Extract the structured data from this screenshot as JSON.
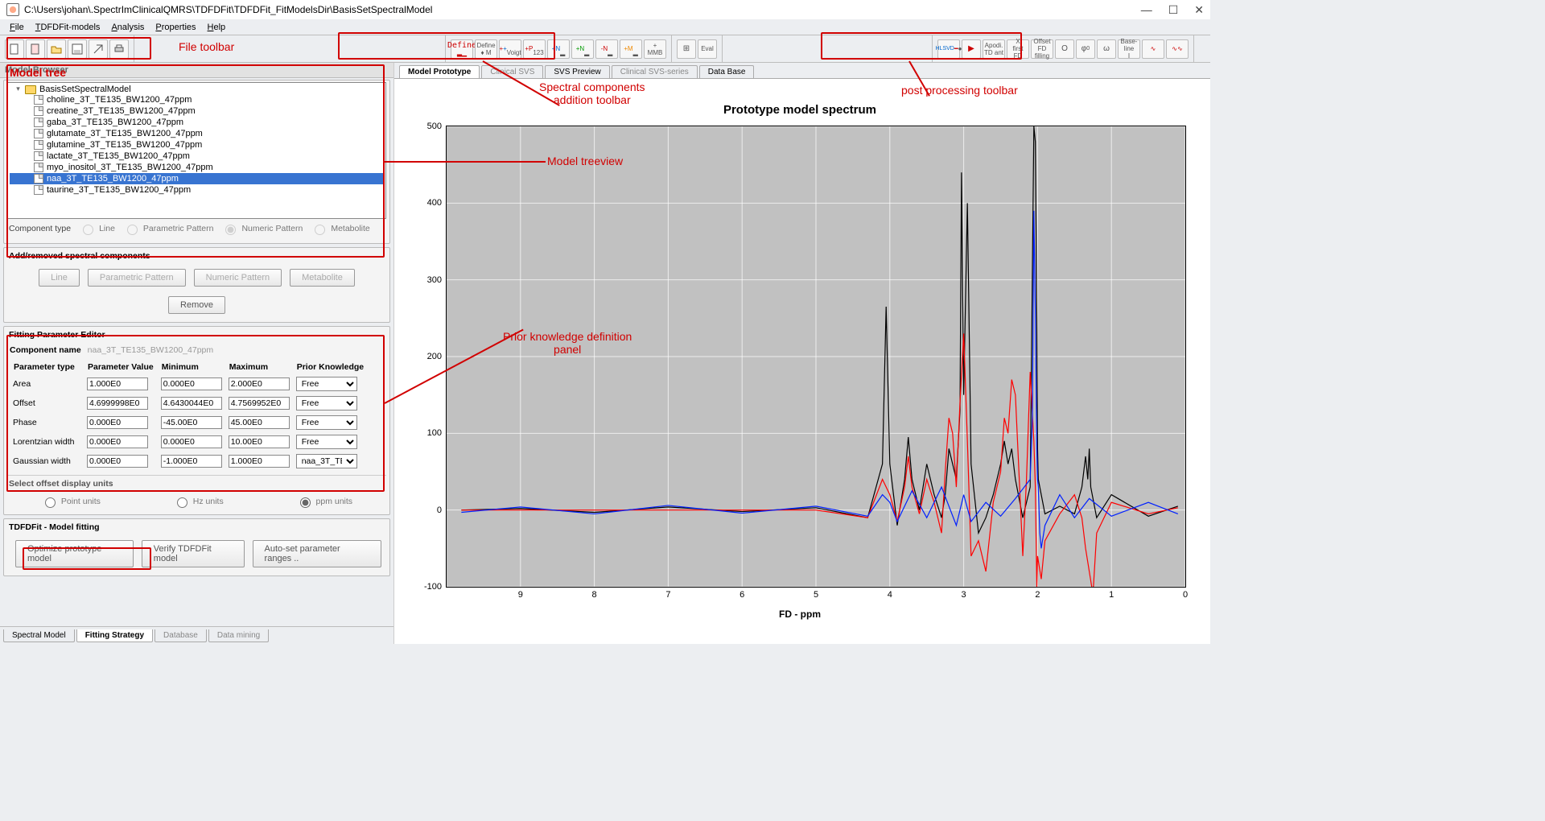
{
  "window": {
    "title": "C:\\Users\\johan\\.SpectrImClinicalQMRS\\TDFDFit\\TDFDFit_FitModelsDir\\BasisSetSpectralModel",
    "controls": {
      "min": "—",
      "max": "☐",
      "close": "✕"
    }
  },
  "menu": [
    "File",
    "TDFDFit-models",
    "Analysis",
    "Properties",
    "Help"
  ],
  "annotations": {
    "file_toolbar": "File toolbar",
    "spectral_toolbar": "Spectral components\naddition toolbar",
    "post_toolbar": "post processing toolbar",
    "model_treeview": "Model treeview",
    "model_tree_hdr": "Model tree",
    "prior_panel": "Prior knowledge definition\npanel"
  },
  "left": {
    "model_browser_title": "Model Browser",
    "tree_root": "BasisSetSpectralModel",
    "tree_items": [
      "choline_3T_TE135_BW1200_47ppm",
      "creatine_3T_TE135_BW1200_47ppm",
      "gaba_3T_TE135_BW1200_47ppm",
      "glutamate_3T_TE135_BW1200_47ppm",
      "glutamine_3T_TE135_BW1200_47ppm",
      "lactate_3T_TE135_BW1200_47ppm",
      "myo_inositol_3T_TE135_BW1200_47ppm",
      "naa_3T_TE135_BW1200_47ppm",
      "taurine_3T_TE135_BW1200_47ppm"
    ],
    "selected_index": 7,
    "component_type_label": "Component type",
    "comp_type_opts": [
      "Line",
      "Parametric Pattern",
      "Numeric Pattern",
      "Metabolite"
    ],
    "add_remove_title": "Add/removed spectral components",
    "add_remove_btns": [
      "Line",
      "Parametric Pattern",
      "Numeric Pattern",
      "Metabolite"
    ],
    "remove_btn": "Remove",
    "fit_editor_title": "Fitting Parameter Editor",
    "comp_name_label": "Component name",
    "comp_name_value": "naa_3T_TE135_BW1200_47ppm",
    "param_headers": [
      "Parameter type",
      "Parameter Value",
      "Minimum",
      "Maximum",
      "Prior Knowledge"
    ],
    "params": [
      {
        "name": "Area",
        "val": "1.000E0",
        "min": "0.000E0",
        "max": "2.000E0",
        "pk": "Free"
      },
      {
        "name": "Offset",
        "val": "4.6999998E0",
        "min": "4.6430044E0",
        "max": "4.7569952E0",
        "pk": "Free"
      },
      {
        "name": "Phase",
        "val": "0.000E0",
        "min": "-45.00E0",
        "max": "45.00E0",
        "pk": "Free"
      },
      {
        "name": "Lorentzian width",
        "val": "0.000E0",
        "min": "0.000E0",
        "max": "10.00E0",
        "pk": "Free"
      },
      {
        "name": "Gaussian width",
        "val": "0.000E0",
        "min": "-1.000E0",
        "max": "1.000E0",
        "pk": "naa_3T_TE1..."
      }
    ],
    "units_title": "Select offset display units",
    "units": [
      "Point units",
      "Hz units",
      "ppm units"
    ],
    "model_fitting_title": "TDFDFit - Model fitting",
    "fit_btns": [
      "Optimize prototype model",
      "Verify TDFDFit model",
      "Auto-set parameter ranges .."
    ],
    "bottom_tabs": [
      "Spectral Model",
      "Fitting Strategy",
      "Database",
      "Data mining"
    ]
  },
  "right": {
    "top_tabs": [
      "Model Prototype",
      "Clinical SVS",
      "SVS Preview",
      "Clinical SVS-series",
      "Data Base"
    ],
    "active_tab": 0
  },
  "chart_data": {
    "type": "line",
    "title": "Prototype model spectrum",
    "xlabel": "FD - ppm",
    "ylabel": "",
    "xlim": [
      10,
      0
    ],
    "ylim": [
      -100,
      500
    ],
    "xticks": [
      9,
      8,
      7,
      6,
      5,
      4,
      3,
      2,
      1,
      0
    ],
    "yticks": [
      -100,
      0,
      100,
      200,
      300,
      400,
      500
    ],
    "series": [
      {
        "name": "black",
        "color": "#000000",
        "x": [
          9.8,
          9.0,
          8.0,
          7.0,
          6.0,
          5.0,
          4.3,
          4.1,
          4.05,
          4.0,
          3.9,
          3.8,
          3.75,
          3.7,
          3.6,
          3.55,
          3.5,
          3.4,
          3.3,
          3.25,
          3.2,
          3.15,
          3.1,
          3.05,
          3.03,
          3.0,
          2.95,
          2.9,
          2.8,
          2.7,
          2.6,
          2.5,
          2.45,
          2.4,
          2.35,
          2.3,
          2.2,
          2.1,
          2.05,
          2.03,
          2.01,
          2.0,
          1.99,
          1.95,
          1.9,
          1.7,
          1.5,
          1.4,
          1.35,
          1.32,
          1.3,
          1.28,
          1.2,
          1.0,
          0.5,
          0.1
        ],
        "values": [
          0,
          2,
          -3,
          4,
          -2,
          3,
          -10,
          60,
          265,
          60,
          -20,
          40,
          95,
          40,
          0,
          30,
          60,
          20,
          -10,
          20,
          80,
          60,
          40,
          130,
          440,
          150,
          400,
          60,
          -30,
          -10,
          20,
          60,
          90,
          60,
          80,
          40,
          -10,
          30,
          500,
          480,
          250,
          80,
          40,
          20,
          -5,
          5,
          -5,
          30,
          70,
          40,
          80,
          30,
          -10,
          20,
          -8,
          5
        ]
      },
      {
        "name": "red",
        "color": "#ff0000",
        "x": [
          9.8,
          5.0,
          4.3,
          4.1,
          4.0,
          3.9,
          3.8,
          3.75,
          3.7,
          3.6,
          3.5,
          3.4,
          3.3,
          3.25,
          3.2,
          3.15,
          3.1,
          3.05,
          3.0,
          2.95,
          2.9,
          2.8,
          2.7,
          2.6,
          2.5,
          2.45,
          2.4,
          2.35,
          2.3,
          2.2,
          2.15,
          2.1,
          2.05,
          2.03,
          2.01,
          2.0,
          1.95,
          1.9,
          1.7,
          1.5,
          1.4,
          1.35,
          1.3,
          1.25,
          1.2,
          1.0,
          0.5,
          0.1
        ],
        "values": [
          0,
          0,
          -10,
          40,
          20,
          -15,
          30,
          70,
          30,
          -5,
          40,
          10,
          -30,
          50,
          120,
          100,
          30,
          140,
          230,
          90,
          -60,
          -40,
          -80,
          10,
          50,
          120,
          100,
          170,
          150,
          -60,
          40,
          180,
          90,
          30,
          -100,
          -60,
          -90,
          -40,
          -5,
          20,
          -10,
          -50,
          -80,
          -110,
          -30,
          10,
          -5,
          3
        ]
      },
      {
        "name": "blue",
        "color": "#0020ff",
        "x": [
          9.8,
          9.0,
          8.0,
          7.0,
          6.0,
          5.0,
          4.3,
          4.1,
          4.0,
          3.9,
          3.7,
          3.5,
          3.3,
          3.1,
          3.0,
          2.9,
          2.7,
          2.5,
          2.3,
          2.1,
          2.07,
          2.05,
          2.03,
          2.01,
          2.0,
          1.99,
          1.97,
          1.95,
          1.9,
          1.7,
          1.5,
          1.3,
          1.0,
          0.5,
          0.1
        ],
        "values": [
          -3,
          4,
          -5,
          6,
          -4,
          5,
          -8,
          20,
          10,
          -15,
          25,
          -10,
          30,
          -20,
          20,
          -15,
          10,
          -8,
          15,
          40,
          120,
          390,
          260,
          80,
          40,
          30,
          -30,
          -50,
          -20,
          20,
          -10,
          15,
          -8,
          10,
          -5
        ]
      }
    ]
  }
}
